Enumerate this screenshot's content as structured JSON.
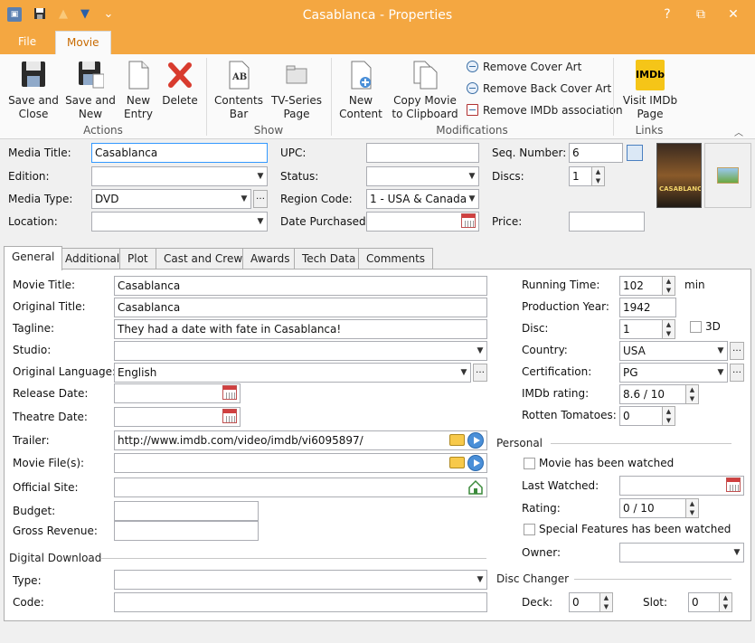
{
  "window": {
    "title": "Casablanca - Properties",
    "help": "?",
    "restore": "⧉",
    "close": "✕"
  },
  "quick_access": {
    "save": "💾",
    "up": "▲",
    "down": "▼",
    "menu": "⌄"
  },
  "ribbon_tabs": [
    "File",
    "Movie"
  ],
  "ribbon": {
    "actions": {
      "label": "Actions",
      "save_close": [
        "Save and",
        "Close"
      ],
      "save_new": [
        "Save and",
        "New"
      ],
      "new_entry": [
        "New",
        "Entry"
      ],
      "delete": "Delete"
    },
    "show": {
      "label": "Show",
      "contents_bar": [
        "Contents",
        "Bar"
      ],
      "tv_series": [
        "TV-Series",
        "Page"
      ]
    },
    "modifications": {
      "label": "Modifications",
      "new_content": [
        "New",
        "Content"
      ],
      "copy_movie": [
        "Copy Movie",
        "to Clipboard"
      ],
      "remove_cover": "Remove Cover Art",
      "remove_back": "Remove Back Cover Art",
      "remove_imdb": "Remove IMDb association"
    },
    "links": {
      "label": "Links",
      "visit_imdb": [
        "Visit IMDb",
        "Page"
      ],
      "imdb_logo": "IMDb"
    }
  },
  "header": {
    "media_title_label": "Media Title:",
    "media_title": "Casablanca",
    "edition_label": "Edition:",
    "edition": "",
    "media_type_label": "Media Type:",
    "media_type": "DVD",
    "location_label": "Location:",
    "location": "",
    "upc_label": "UPC:",
    "upc": "",
    "status_label": "Status:",
    "status": "",
    "region_label": "Region Code:",
    "region": "1 - USA & Canada",
    "date_purchased_label": "Date Purchased:",
    "date_purchased": "",
    "seq_label": "Seq. Number:",
    "seq": "6",
    "discs_label": "Discs:",
    "discs": "1",
    "price_label": "Price:",
    "price": "",
    "cover_text": "CASABLANCA"
  },
  "tabs": [
    "General",
    "Additional",
    "Plot",
    "Cast and Crew",
    "Awards",
    "Tech Data",
    "Comments"
  ],
  "general": {
    "movie_title_label": "Movie Title:",
    "movie_title": "Casablanca",
    "original_title_label": "Original Title:",
    "original_title": "Casablanca",
    "tagline_label": "Tagline:",
    "tagline": "They had a date with fate in Casablanca!",
    "studio_label": "Studio:",
    "studio": "",
    "orig_lang_label": "Original Language:",
    "orig_lang": "English",
    "release_label": "Release Date:",
    "release": "",
    "theatre_label": "Theatre Date:",
    "theatre": "",
    "trailer_label": "Trailer:",
    "trailer": "http://www.imdb.com/video/imdb/vi6095897/",
    "movie_files_label": "Movie File(s):",
    "movie_files": "",
    "official_site_label": "Official Site:",
    "official_site": "",
    "budget_label": "Budget:",
    "budget": "",
    "gross_label": "Gross Revenue:",
    "gross": "",
    "digital_download": "Digital Download",
    "type_label": "Type:",
    "type": "",
    "code_label": "Code:",
    "code": "",
    "running_label": "Running Time:",
    "running": "102",
    "running_unit": "min",
    "prod_year_label": "Production Year:",
    "prod_year": "1942",
    "disc_label": "Disc:",
    "disc": "1",
    "three_d": "3D",
    "country_label": "Country:",
    "country": "USA",
    "cert_label": "Certification:",
    "cert": "PG",
    "imdb_label": "IMDb rating:",
    "imdb": "8.6 / 10",
    "rotten_label": "Rotten Tomatoes:",
    "rotten": "0",
    "personal": "Personal",
    "watched": "Movie has been watched",
    "last_watched_label": "Last Watched:",
    "last_watched": "",
    "rating_label": "Rating:",
    "rating": "0 / 10",
    "special": "Special Features has been watched",
    "owner_label": "Owner:",
    "owner": "",
    "disc_changer": "Disc Changer",
    "deck_label": "Deck:",
    "deck": "0",
    "slot_label": "Slot:",
    "slot": "0"
  }
}
